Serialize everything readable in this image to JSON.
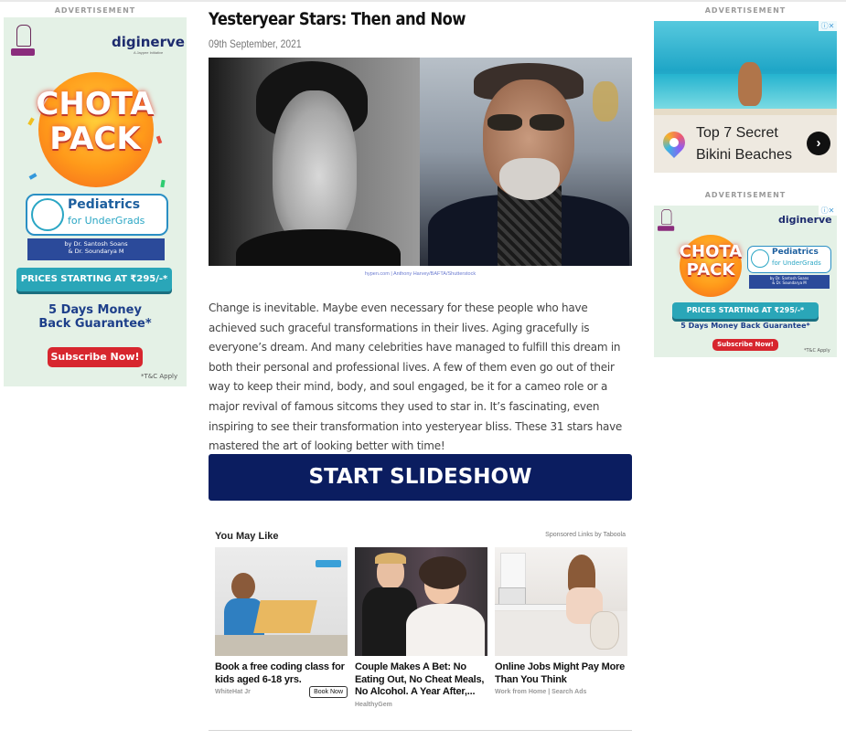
{
  "ads": {
    "label": "ADVERTISEMENT",
    "left": {
      "brand": "diginerve",
      "brand_sub": "A Jaypee Initiative",
      "headline_1": "CHOTA",
      "headline_2": "PACK",
      "course_1": "Pediatrics",
      "course_2": "for UnderGrads",
      "authors_1": "by Dr. Santosh Soans",
      "authors_2": "& Dr. Soundarya M",
      "price": "PRICES STARTING AT ₹295/-*",
      "guarantee_1": "5 Days Money",
      "guarantee_2": "Back Guarantee*",
      "cta": "Subscribe Now!",
      "tc": "*T&C Apply"
    },
    "right_top": {
      "title": "Top 7 Secret Bikini Beaches",
      "arrow": "›"
    },
    "right_bottom": {
      "brand": "diginerve",
      "headline_1": "CHOTA",
      "headline_2": "PACK",
      "course_1": "Pediatrics",
      "course_2": "for UnderGrads",
      "authors_1": "by Dr. Santosh Soans",
      "authors_2": "& Dr. Soundarya M",
      "price": "PRICES STARTING AT ₹295/-*",
      "guarantee": "5 Days Money Back Guarantee*",
      "cta": "Subscribe Now!",
      "tc": "*T&C Apply"
    }
  },
  "article": {
    "title": "Yesteryear Stars: Then and Now",
    "date": "09th September, 2021",
    "image_credit": "hypen.com | Anthony Harvey/BAFTA/Shutterstock",
    "body": "Change is inevitable. Maybe even necessary for these people who have achieved such graceful transformations in their lives. Aging gracefully is everyone’s dream. And many celebrities have managed to fulfill this dream in both their personal and professional lives. A few of them even go out of their way to keep their mind, body, and soul engaged, be it for a cameo role or a major revival of famous sitcoms they used to star in. It’s fascinating, even inspiring to see their transformation into yesteryear bliss. These 31 stars have mastered the art of looking better with time!",
    "cta": "START SLIDESHOW"
  },
  "recommendations": {
    "heading": "You May Like",
    "sponsored": "Sponsored Links by Taboola",
    "items": [
      {
        "title": "Book a free coding class for kids aged 6-18 yrs.",
        "source": "WhiteHat Jr",
        "button": "Book Now"
      },
      {
        "title": "Couple Makes A Bet: No Eating Out, No Cheat Meals, No Alcohol. A Year After,...",
        "source": "HealthyGem"
      },
      {
        "title": "Online Jobs Might Pay More Than You Think",
        "source": "Work from Home | Search Ads"
      }
    ]
  }
}
